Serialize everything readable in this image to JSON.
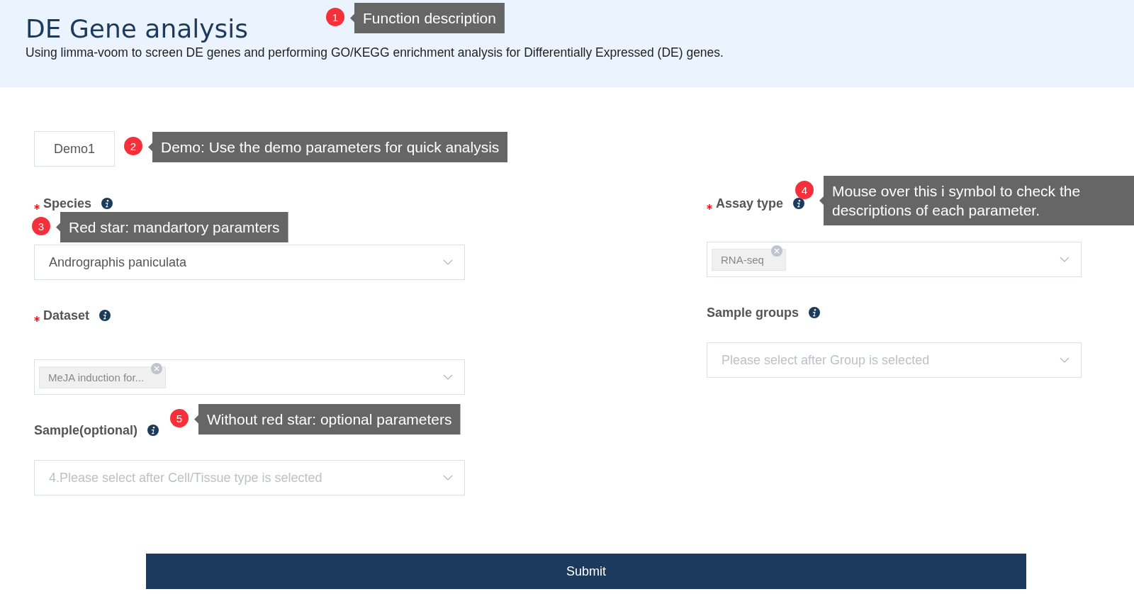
{
  "header": {
    "title": "DE Gene analysis",
    "description": "Using limma-voom to screen DE genes and performing GO/KEGG enrichment analysis for Differentially Expressed (DE) genes."
  },
  "demo_button": "Demo1",
  "left_fields": [
    {
      "label": "Species",
      "required": true,
      "value": "Andrographis paniculata"
    },
    {
      "label": "Dataset",
      "required": true,
      "tags": [
        "MeJA induction for..."
      ]
    },
    {
      "label": "Sample(optional)",
      "required": false,
      "placeholder": "4.Please select after Cell/Tissue type is selected"
    }
  ],
  "right_fields": [
    {
      "label": "Assay type",
      "required": true,
      "tags": [
        "RNA-seq"
      ]
    },
    {
      "label": "Sample groups",
      "required": false,
      "placeholder": "Please select after Group is selected"
    }
  ],
  "submit_button": "Submit",
  "callouts": [
    {
      "number": "1",
      "text": "Function description"
    },
    {
      "number": "2",
      "text": "Demo: Use the demo parameters for quick analysis"
    },
    {
      "number": "3",
      "text": "Red star: mandartory paramters"
    },
    {
      "number": "4",
      "text": "Mouse over this i symbol to check the descriptions of each parameter."
    },
    {
      "number": "5",
      "text": "Without red star: optional parameters"
    }
  ]
}
